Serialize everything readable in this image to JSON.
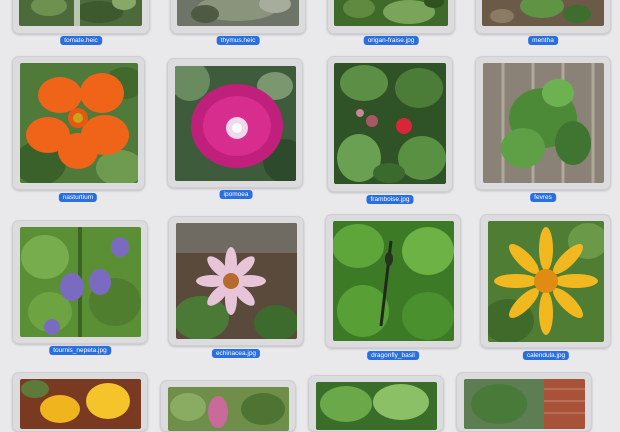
{
  "files": [
    {
      "name": "tomate.heic",
      "icon": "plant-foliage-photo"
    },
    {
      "name": "thymus.heic",
      "icon": "thyme-photo"
    },
    {
      "name": "origan-fraise.jpg",
      "icon": "oregano-photo"
    },
    {
      "name": "mentha",
      "icon": "mint-photo"
    },
    {
      "name": "nasturtium",
      "icon": "orange-nasturtium-photo"
    },
    {
      "name": "ipomoea",
      "icon": "magenta-morning-glory-photo"
    },
    {
      "name": "framboise.jpg",
      "icon": "raspberry-plant-photo"
    },
    {
      "name": "fevres",
      "icon": "bean-plant-photo"
    },
    {
      "name": "tournis_nepeta.jpg",
      "icon": "purple-nepeta-photo"
    },
    {
      "name": "echinacea.jpg",
      "icon": "pink-echinacea-photo"
    },
    {
      "name": "dragonfly_basil",
      "icon": "dragonfly-on-basil-photo"
    },
    {
      "name": "calendula.jpg",
      "icon": "yellow-calendula-photo"
    },
    {
      "name": "",
      "icon": "yellow-lily-photo"
    },
    {
      "name": "",
      "icon": "pink-flower-photo"
    },
    {
      "name": "",
      "icon": "green-leaves-photo"
    },
    {
      "name": "",
      "icon": "plant-by-brick-wall-photo"
    }
  ],
  "colors": {
    "selection": "#2a6fe0",
    "background": "#e9e9ec"
  }
}
